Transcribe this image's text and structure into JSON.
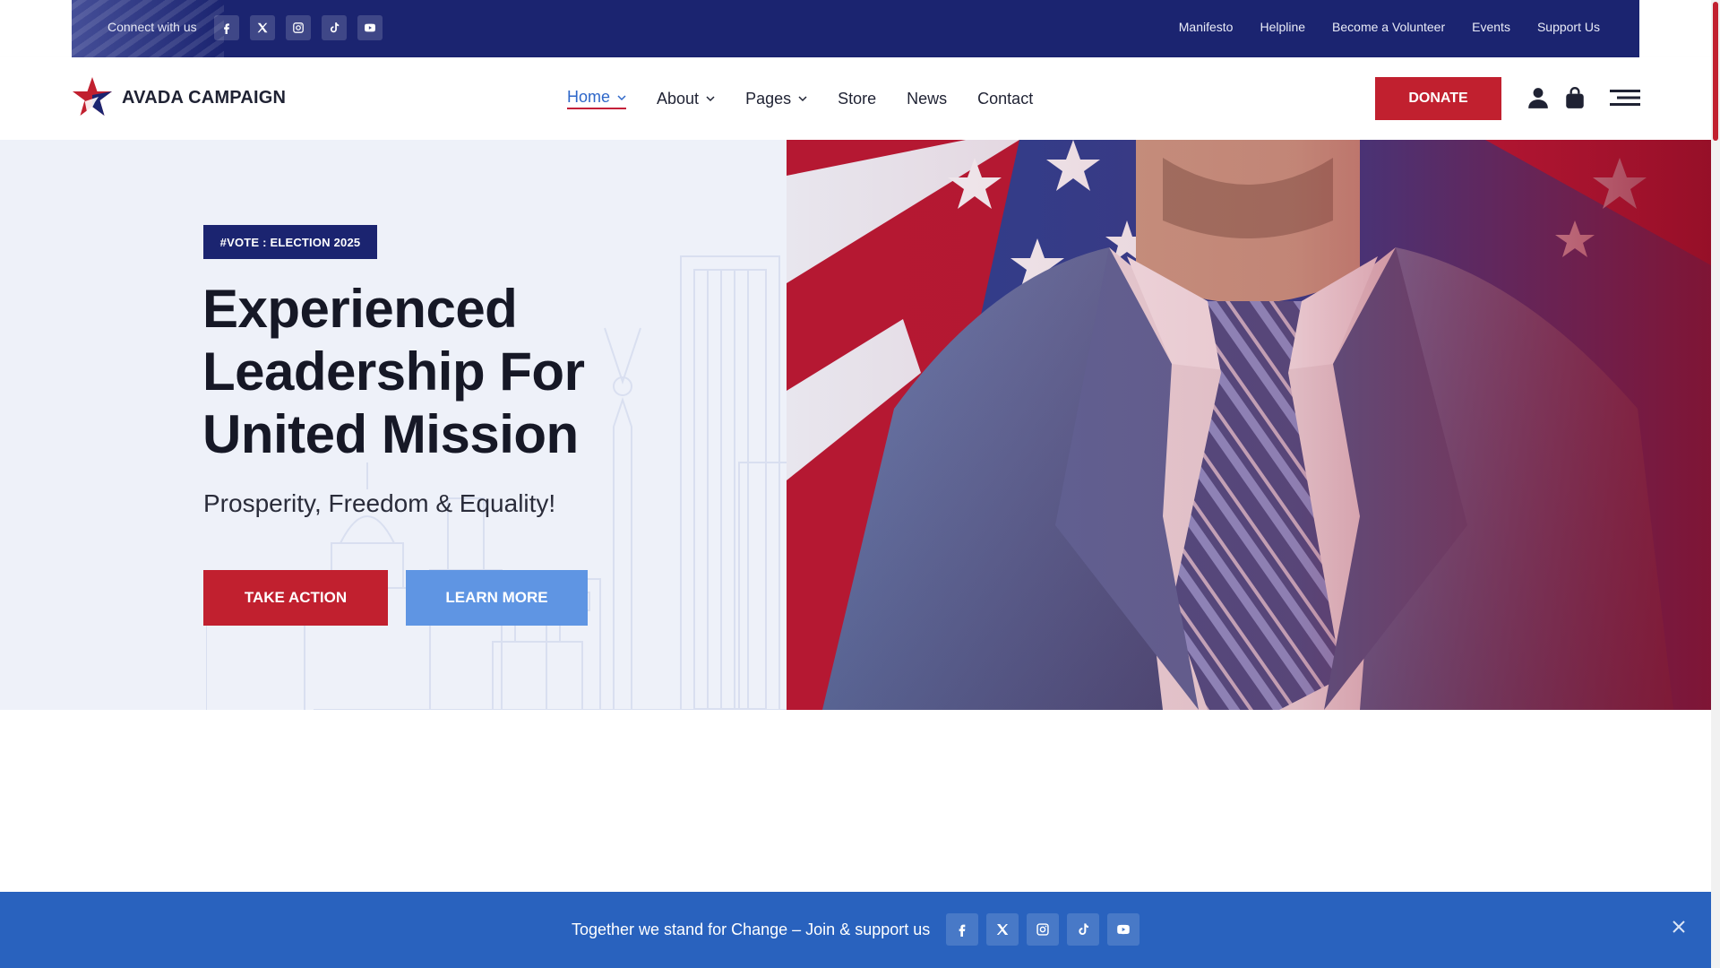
{
  "topbar": {
    "connect_label": "Connect with us",
    "social": [
      {
        "icon": "facebook-icon",
        "glyph": "f"
      },
      {
        "icon": "x-twitter-icon",
        "glyph": "X"
      },
      {
        "icon": "instagram-icon",
        "glyph": "◎"
      },
      {
        "icon": "tiktok-icon",
        "glyph": "♪"
      },
      {
        "icon": "youtube-icon",
        "glyph": "▶"
      }
    ],
    "links": [
      "Manifesto",
      "Helpline",
      "Become a Volunteer",
      "Events",
      "Support Us"
    ]
  },
  "header": {
    "brand": "AVADA CAMPAIGN",
    "nav": [
      {
        "label": "Home",
        "has_dropdown": true,
        "active": true
      },
      {
        "label": "About",
        "has_dropdown": true,
        "active": false
      },
      {
        "label": "Pages",
        "has_dropdown": true,
        "active": false
      },
      {
        "label": "Store",
        "has_dropdown": false,
        "active": false
      },
      {
        "label": "News",
        "has_dropdown": false,
        "active": false
      },
      {
        "label": "Contact",
        "has_dropdown": false,
        "active": false
      }
    ],
    "donate_label": "DONATE",
    "icons": [
      "user-icon",
      "shopping-bag-icon",
      "menu-icon"
    ]
  },
  "hero": {
    "tag": "#VOTE : ELECTION 2025",
    "headline_lines": [
      "Experienced",
      "Leadership For",
      "United Mission"
    ],
    "subline": "Prosperity, Freedom & Equality!",
    "primary_button": "TAKE ACTION",
    "secondary_button": "LEARN MORE"
  },
  "bottom_bar": {
    "message": "Together we stand for Change – Join & support us",
    "social": [
      "facebook-icon",
      "x-twitter-icon",
      "instagram-icon",
      "tiktok-icon",
      "youtube-icon"
    ],
    "close_icon": "close-icon"
  },
  "colors": {
    "navy": "#1b2470",
    "red": "#c1202f",
    "blue": "#2962be",
    "light_blue": "#5f95e3",
    "hero_bg": "#eef1f9"
  }
}
